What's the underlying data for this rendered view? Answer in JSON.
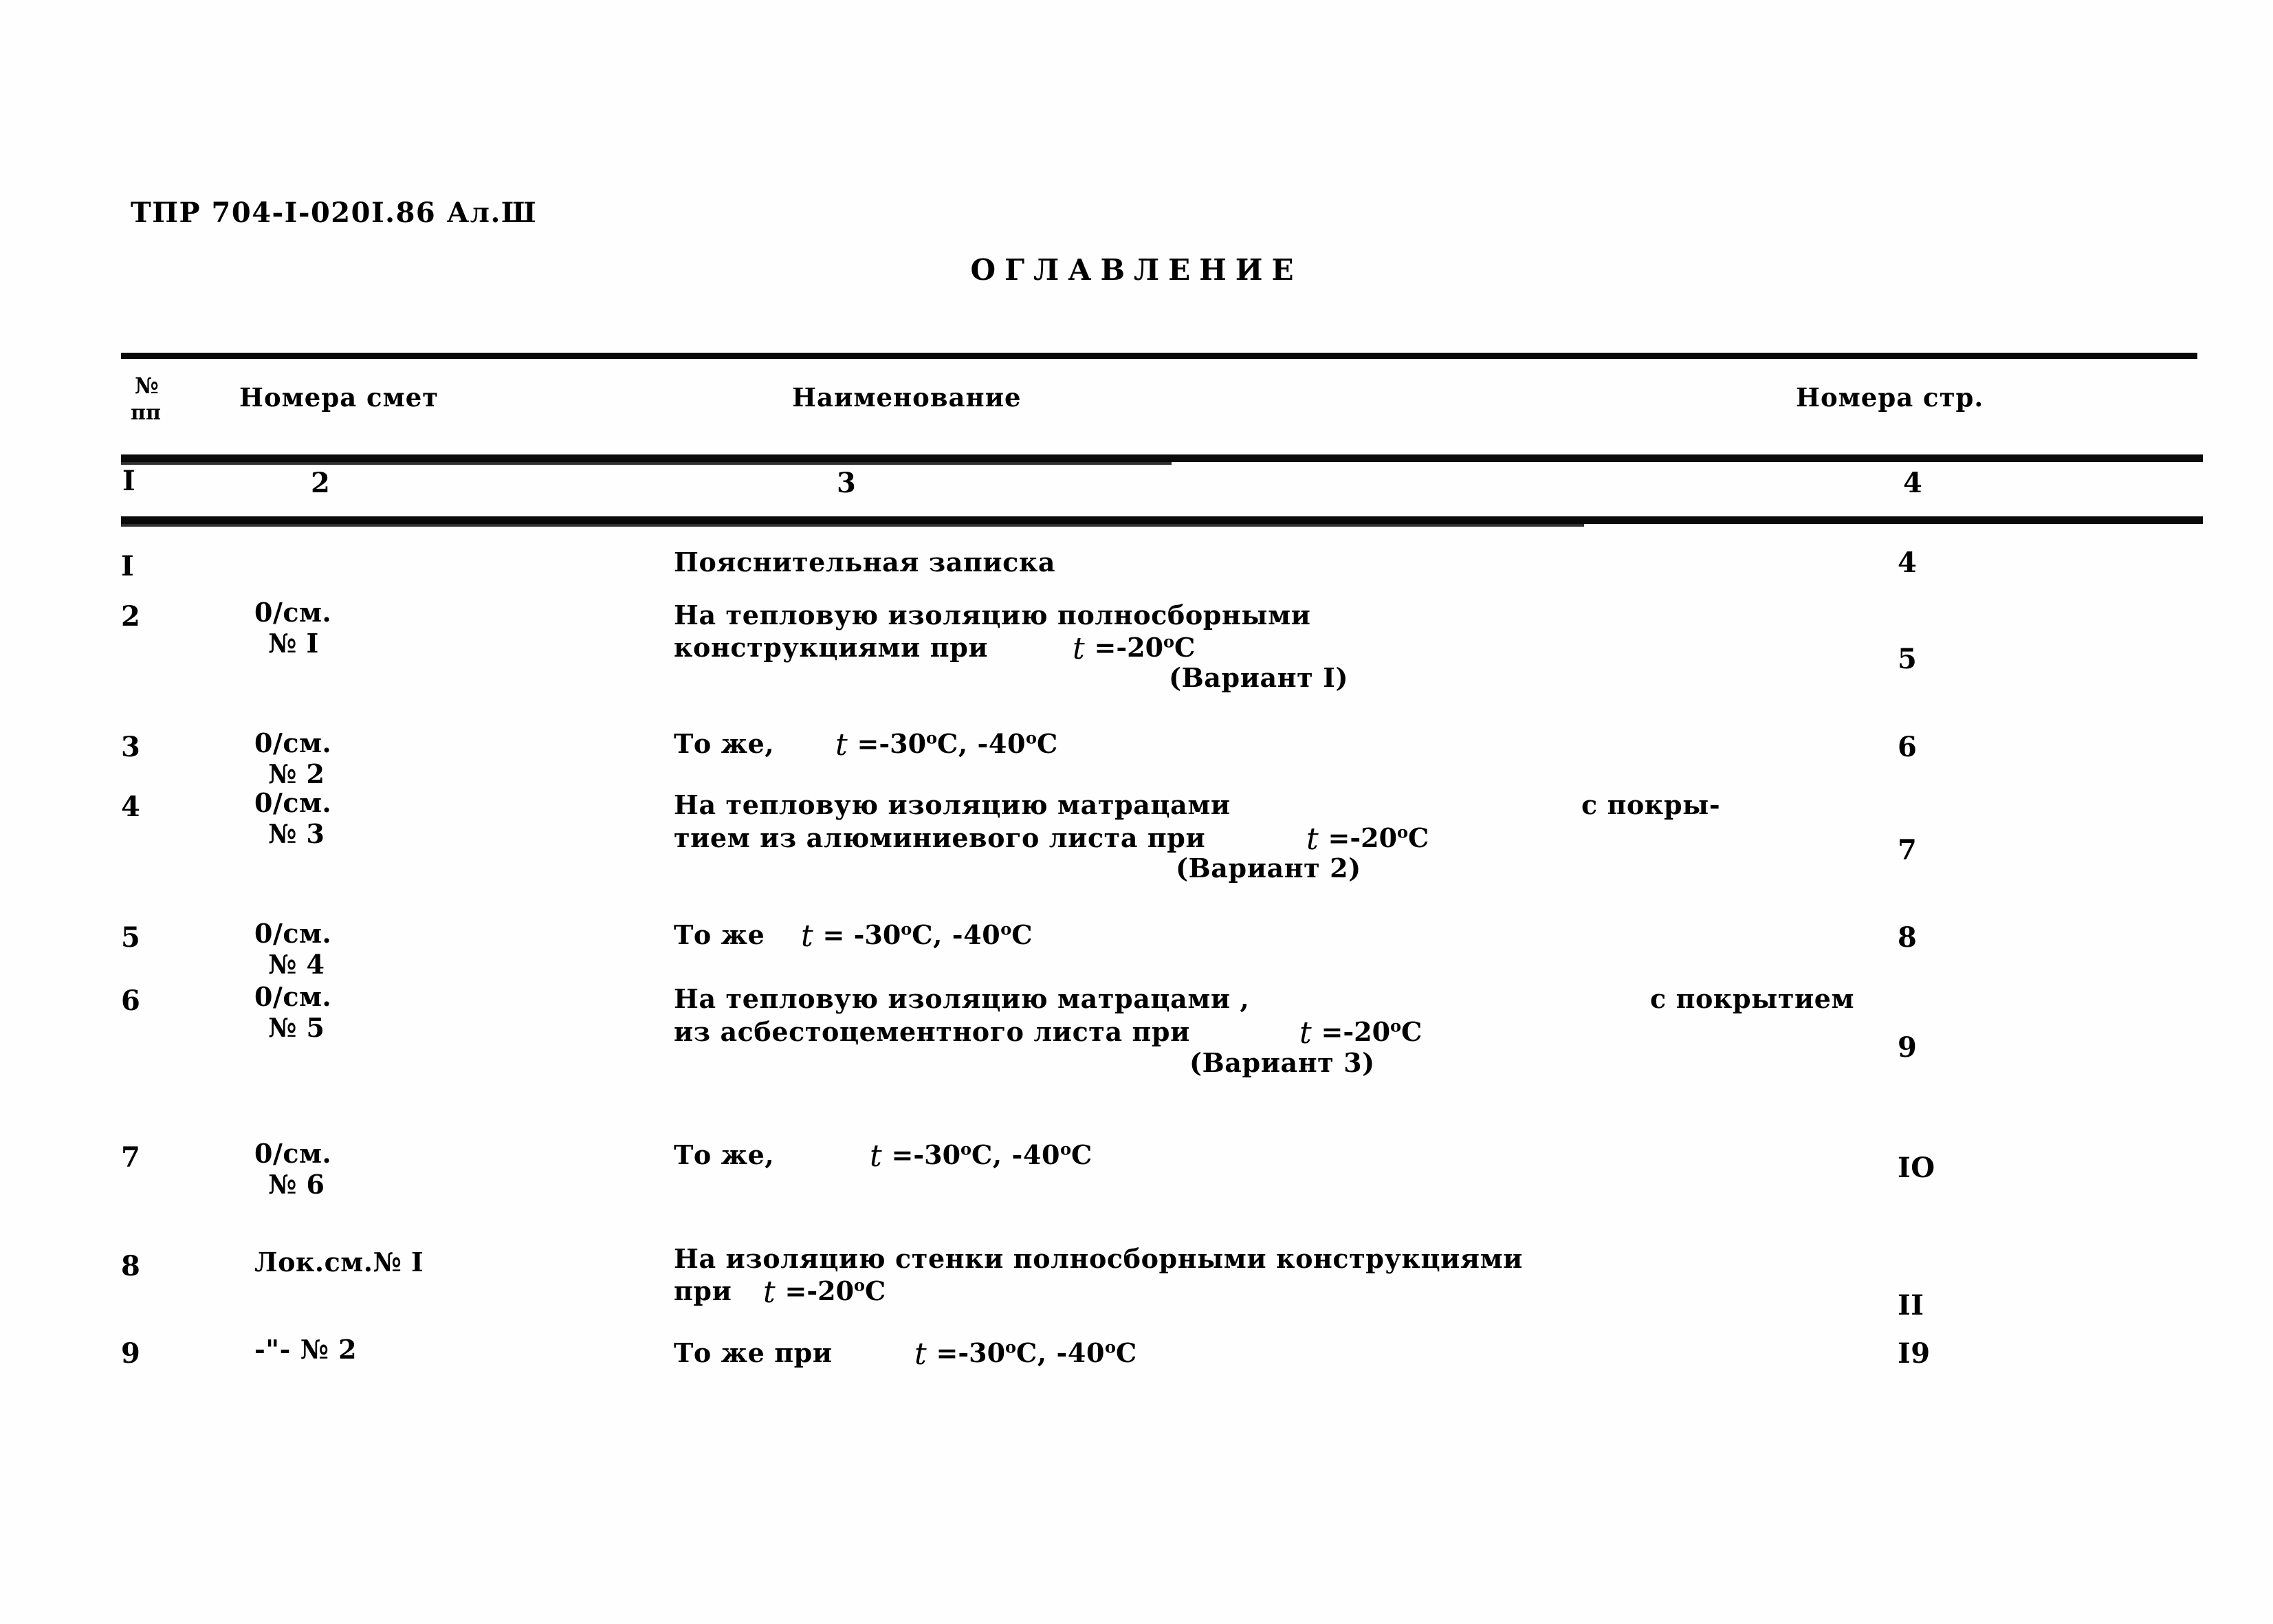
{
  "document": {
    "code": "ТПР 704-I-020I.86    Ал.Ш",
    "title": "ОГЛАВЛЕНИЕ"
  },
  "table": {
    "headers": {
      "no_symbol": "№",
      "no_pp": "пп",
      "smeta": "Номера смет",
      "name": "Наименование",
      "page": "Номера стр."
    },
    "column_numbers": {
      "c1": "I",
      "c2": "2",
      "c3": "3",
      "c4": "4"
    },
    "rows": [
      {
        "no": "I",
        "smeta": [
          "",
          ""
        ],
        "name_l1": "Пояснительная записка",
        "name_l2": "",
        "name_l3": "",
        "tail1": "",
        "page": "4"
      },
      {
        "no": "2",
        "smeta": [
          "0/см.",
          "№ I"
        ],
        "name_l1": "На тепловую изоляцию  полносборными",
        "name_l2": "конструкциями при",
        "temp2": "=-20",
        "temp2_unit": "С",
        "name_l3": "(Вариант I)",
        "tail1": "",
        "page": "5"
      },
      {
        "no": "3",
        "smeta": [
          "0/см.",
          "№ 2"
        ],
        "name_l1": "То же,",
        "temp1": "=-30",
        "temp1_unit": "С, -40",
        "temp1_unit2": "С",
        "name_l2": "",
        "name_l3": "",
        "tail1": "",
        "page": "6"
      },
      {
        "no": "4",
        "smeta": [
          "0/см.",
          "№ 3"
        ],
        "name_l1": "На тепловую изоляцию матрацами",
        "tail1": "с покры-",
        "name_l2": "тием из алюминиевого листа при",
        "temp2": "=-20",
        "temp2_unit": "С",
        "name_l3": "(Вариант 2)",
        "page": "7"
      },
      {
        "no": "5",
        "smeta": [
          "0/см.",
          "№ 4"
        ],
        "name_l1": "То же",
        "temp1": "= -30",
        "temp1_unit": "С, -40",
        "temp1_unit2": "С",
        "name_l2": "",
        "name_l3": "",
        "tail1": "",
        "page": "8"
      },
      {
        "no": "6",
        "smeta": [
          "0/см.",
          "№ 5"
        ],
        "name_l1": "На тепловую изоляцию матрацами ,",
        "tail1": "с покрытием",
        "name_l2": "из асбестоцементного листа при",
        "temp2": "=-20",
        "temp2_unit": "С",
        "name_l3": "(Вариант 3)",
        "page": "9"
      },
      {
        "no": "7",
        "smeta": [
          "0/см.",
          "№ 6"
        ],
        "name_l1": "То же,",
        "temp1": "=-30",
        "temp1_unit": "С,  -40",
        "temp1_unit2": "С",
        "name_l2": "",
        "name_l3": "",
        "tail1": "",
        "page": "IO"
      },
      {
        "no": "8",
        "smeta": [
          "Лок.см.№ I",
          ""
        ],
        "name_l1": "На изоляцию стенки полносборными конструкциями",
        "name_l2": "при",
        "temp2": "=-20",
        "temp2_unit": "С",
        "name_l3": "",
        "tail1": "",
        "page": "II"
      },
      {
        "no": "9",
        "smeta": [
          "-\"-    № 2",
          ""
        ],
        "name_l1": "То же при",
        "temp1": "=-30",
        "temp1_unit": "С, -40",
        "temp1_unit2": "С",
        "name_l2": "",
        "name_l3": "",
        "tail1": "",
        "page": "I9"
      }
    ]
  }
}
